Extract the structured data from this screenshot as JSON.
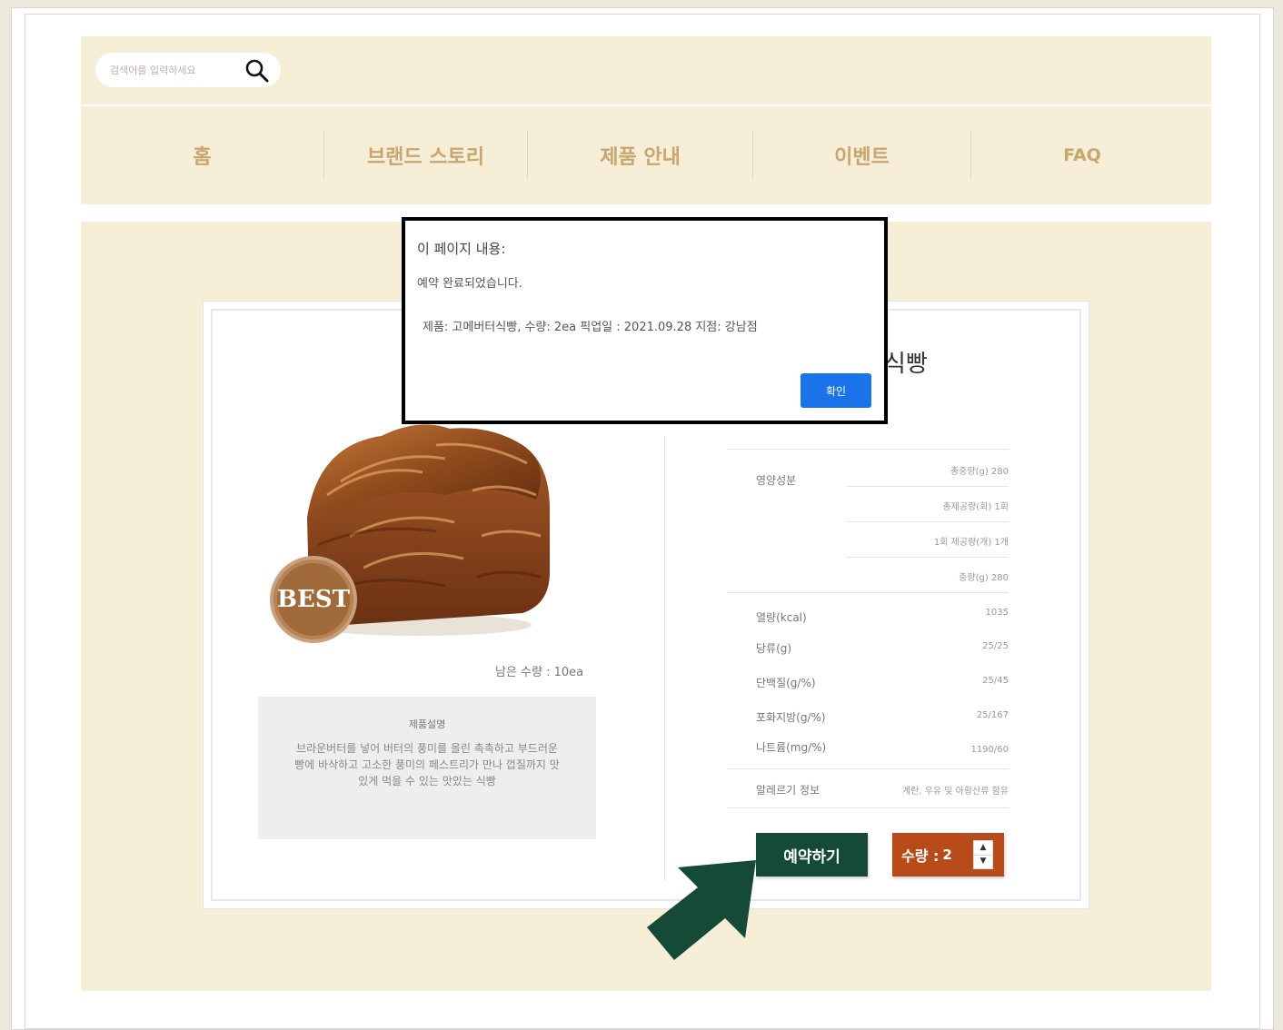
{
  "search": {
    "placeholder": "검색어를 입력하세요"
  },
  "nav": {
    "items": [
      {
        "label": "홈"
      },
      {
        "label": "브랜드 스토리"
      },
      {
        "label": "제품 안내"
      },
      {
        "label": "이벤트"
      },
      {
        "label": "FAQ"
      }
    ]
  },
  "product": {
    "title_partial": "식빵",
    "badge": "BEST",
    "stock": "남은 수량 : 10ea",
    "description_title": "제품설명",
    "description": "브라운버터를 넣어 버터의 풍미를 올린 촉촉하고 부드러운 빵에 바삭하고 고소한 풍미의 페스트리가 만나 껍질까지 맛있게 먹을 수 있는 맛있는 식빵"
  },
  "nutrition": {
    "group_label": "영양성분",
    "group_rows": [
      {
        "value": "총중량(g) 280"
      },
      {
        "value": "총제공량(회) 1회"
      },
      {
        "value": "1회 제공량(개) 1개"
      },
      {
        "value": "중량(g) 280"
      }
    ],
    "rows": [
      {
        "label": "열량(kcal)",
        "value": "1035"
      },
      {
        "label": "당류(g)",
        "value": "25/25"
      },
      {
        "label": "단백질(g/%)",
        "value": "25/45"
      },
      {
        "label": "포화지방(g/%)",
        "value": "25/167"
      },
      {
        "label": "나트륨(mg/%)",
        "value": "1190/60"
      }
    ],
    "allergy_label": "알레르기 정보",
    "allergy_value": "계란, 우유 및 아황산류 함유"
  },
  "actions": {
    "reserve_label": "예약하기",
    "qty_label": "수량 :",
    "qty_value": "2"
  },
  "dialog": {
    "title": "이 페이지 내용:",
    "message": "예약 완료되었습니다.",
    "detail": "제품: 고메버터식빵, 수량: 2ea 픽업일 : 2021.09.28 지점: 강남점",
    "ok_label": "확인"
  },
  "colors": {
    "reserve": "#154a37",
    "quantity": "#b94b1b",
    "header_bg": "#f6eed7",
    "nav_text": "#c9a570",
    "dialog_button": "#1a73e8",
    "arrow": "#154a37"
  }
}
